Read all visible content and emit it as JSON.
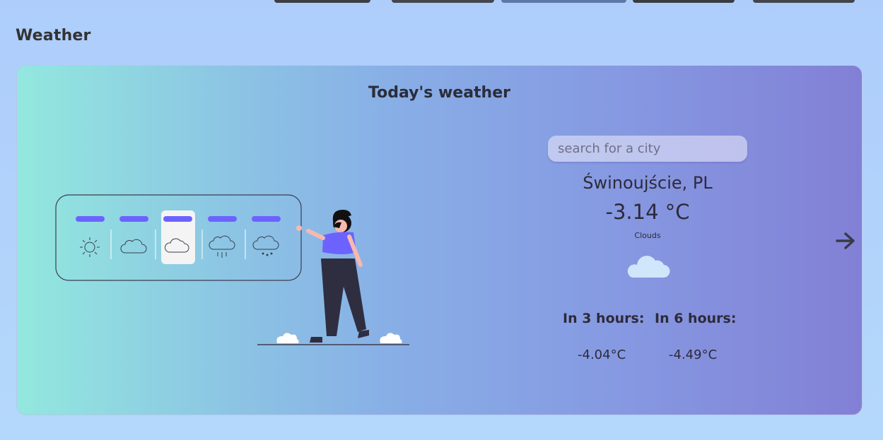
{
  "section": {
    "title": "Weather"
  },
  "card": {
    "title": "Today's weather",
    "search": {
      "placeholder": "search for a city",
      "value": ""
    },
    "city": "Świnoujście, PL",
    "temperature": "-3.14 °C",
    "condition": "Clouds",
    "forecast": [
      {
        "label": "In 3 hours:",
        "value": "-4.04°C"
      },
      {
        "label": "In 6 hours:",
        "value": "-4.49°C"
      }
    ]
  },
  "icons": {
    "current": "cloud-icon",
    "next": "arrow-right-icon",
    "illustration_options": [
      "sun-icon",
      "cloud-icon",
      "cloud-icon",
      "rain-icon",
      "snow-icon"
    ]
  },
  "colors": {
    "accent": "#6c63ff",
    "text": "#2d2a3a",
    "gradient_start": "#92e8de",
    "gradient_end": "#8280d6"
  }
}
